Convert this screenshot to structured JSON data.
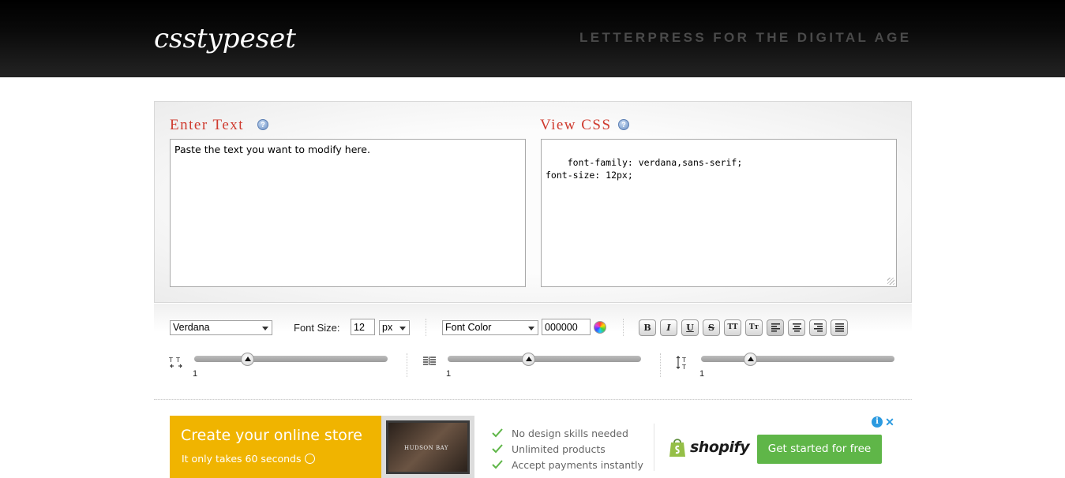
{
  "header": {
    "logo_text": "csstypeset",
    "tagline": "LETTERPRESS FOR THE DIGITAL AGE"
  },
  "editor": {
    "enter_text_title": "Enter Text",
    "view_css_title": "View CSS",
    "help_icon_glyph": "?",
    "input_text": "Paste the text you want to modify here.",
    "css_output": "font-family: verdana,sans-serif;\nfont-size: 12px;"
  },
  "toolbar": {
    "font_family": "Verdana",
    "font_size_label": "Font Size:",
    "font_size_value": "12",
    "font_size_unit": "px",
    "font_color_select": "Font Color",
    "font_color_value": "000000",
    "format_buttons": [
      "B",
      "I",
      "U",
      "S",
      "TT",
      "Tт"
    ],
    "alignment_buttons": [
      "align-left-icon",
      "align-center-icon",
      "align-right-icon",
      "align-justify-icon"
    ],
    "sliders": [
      {
        "name": "letter-spacing",
        "value": "1",
        "level": 0.3
      },
      {
        "name": "line-height",
        "value": "1",
        "level": 0.42
      },
      {
        "name": "word-spacing",
        "value": "1",
        "level": 0.26
      }
    ]
  },
  "ad": {
    "title": "Create your online store",
    "subtitle": "It only takes 60 seconds",
    "image_text": "HUDSON BAY",
    "features": [
      "No design skills needed",
      "Unlimited products",
      "Accept payments instantly"
    ],
    "brand": "shopify",
    "cta": "Get started for free",
    "info_glyph": "i",
    "close_glyph": "✕"
  },
  "colors": {
    "title_red": "#cf3b2f",
    "ad_yellow": "#f0b400",
    "cta_green": "#5fb648",
    "header_black": "#000000"
  }
}
